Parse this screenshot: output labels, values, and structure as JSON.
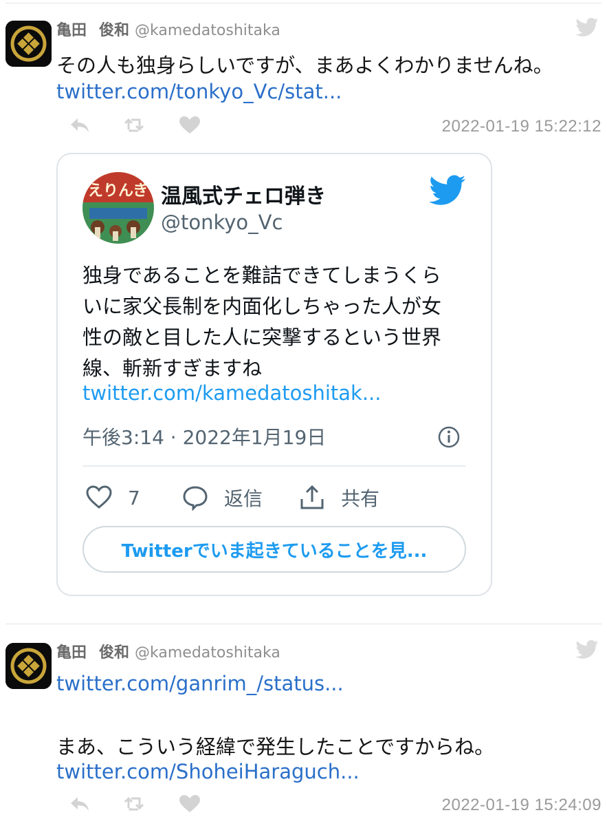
{
  "tweets": [
    {
      "author_name": "亀田",
      "author_name2": "俊和",
      "author_handle": "@kamedatoshitaka",
      "text": "その人も独身らしいですが、まあよくわかりませんね。",
      "link": "twitter.com/tonkyo_Vc/stat...",
      "timestamp": "2022-01-19 15:22:12"
    },
    {
      "author_name": "亀田",
      "author_name2": "俊和",
      "author_handle": "@kamedatoshitaka",
      "link": "twitter.com/ganrim_/status...",
      "text": "まあ、こういう経緯で発生したことですからね。",
      "link2": "twitter.com/ShoheiHaraguch...",
      "timestamp": "2022-01-19 15:24:09"
    }
  ],
  "embed": {
    "name": "温風式チェロ弾き",
    "handle": "@tonkyo_Vc",
    "body_lines": [
      "独身であることを難詰できてしまうくら",
      "いに家父長制を内面化しちゃった人が女",
      "性の敵と目した人に突撃するという世界",
      "線、斬新すぎますね"
    ],
    "link": "twitter.com/kamedatoshitak...",
    "meta": "午後3:14 · 2022年1月19日",
    "like_count": "7",
    "reply_label": "返信",
    "share_label": "共有",
    "button_label": "Twitterでいま起きていることを見..."
  },
  "icons": {
    "bird_gray": "twitter-bird-icon",
    "bird_blue": "twitter-bird-icon",
    "reply": "reply-icon",
    "retweet": "retweet-icon",
    "like": "heart-icon",
    "info": "info-icon",
    "share": "share-icon"
  },
  "colors": {
    "link": "#2a6fc9",
    "twitter_blue": "#1d9bf0",
    "muted": "#9a9a9a"
  }
}
